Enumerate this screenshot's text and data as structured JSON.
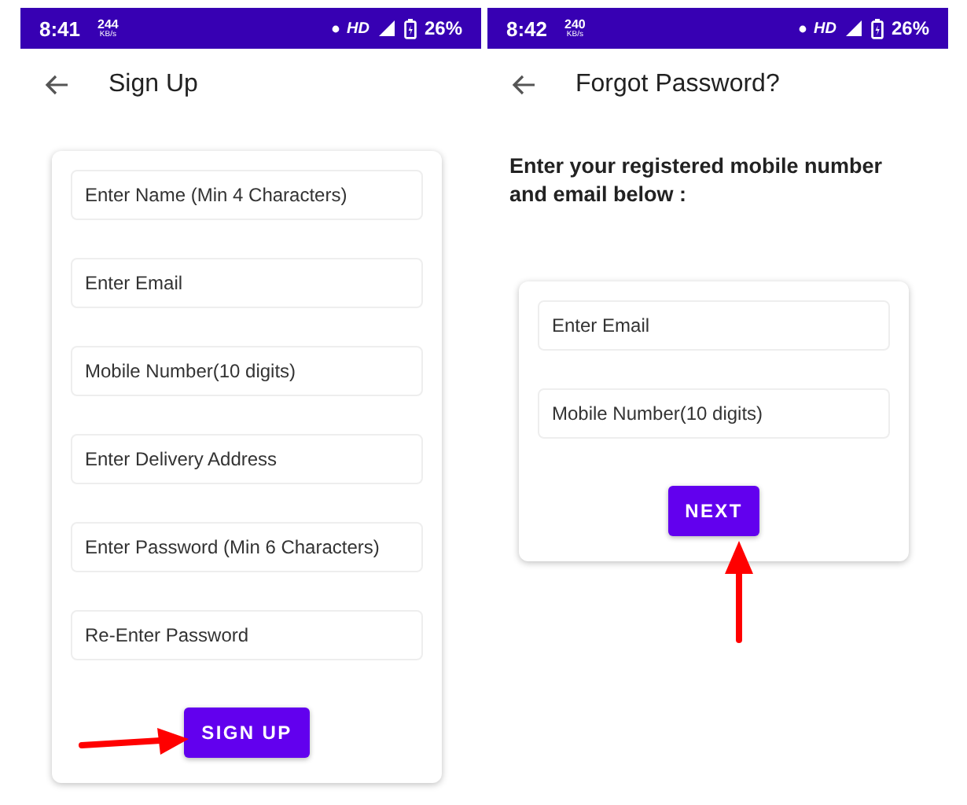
{
  "screens": [
    {
      "status_bar": {
        "time": "8:41",
        "speed": "244",
        "speed_unit": "KB/s",
        "network": "HD",
        "battery": "26%"
      },
      "title": "Sign Up",
      "fields": [
        {
          "placeholder": "Enter Name (Min 4 Characters)"
        },
        {
          "placeholder": "Enter Email"
        },
        {
          "placeholder": "Mobile Number(10 digits)"
        },
        {
          "placeholder": "Enter Delivery Address"
        },
        {
          "placeholder": "Enter Password (Min 6 Characters)"
        },
        {
          "placeholder": "Re-Enter Password"
        }
      ],
      "button": "SIGN UP",
      "annotation": {
        "kind": "left"
      }
    },
    {
      "status_bar": {
        "time": "8:42",
        "speed": "240",
        "speed_unit": "KB/s",
        "network": "HD",
        "battery": "26%"
      },
      "title": "Forgot Password?",
      "instruction": "Enter your registered mobile number and email below :",
      "fields": [
        {
          "placeholder": "Enter Email"
        },
        {
          "placeholder": "Mobile Number(10 digits)"
        }
      ],
      "button": "NEXT",
      "annotation": {
        "kind": "below"
      }
    }
  ]
}
